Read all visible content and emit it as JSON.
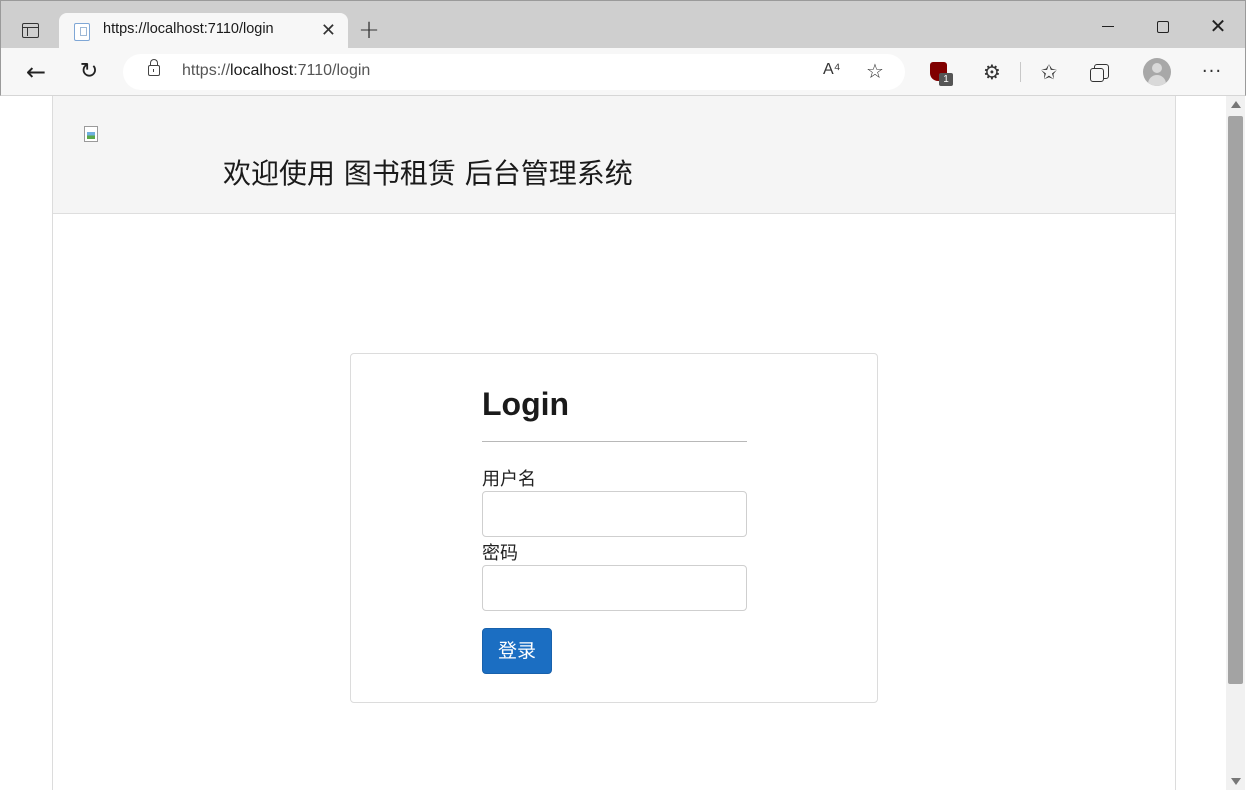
{
  "browser": {
    "tab": {
      "title": "https://localhost:7110/login",
      "close_glyph": "✕"
    },
    "new_tab_glyph": "+",
    "window_controls": {
      "close_glyph": "✕"
    },
    "address": {
      "scheme": "https://",
      "host": "localhost",
      "rest": ":7110/login",
      "read_aloud_glyph": "A⁴",
      "favorite_glyph": "☆"
    },
    "nav": {
      "back_glyph": "←",
      "reload_glyph": "↻"
    },
    "toolbar": {
      "ublock_badge": "1",
      "extensions_glyph": "⚙",
      "favorites_glyph": "✩",
      "menu_glyph": "···"
    },
    "icons": [
      "sidebar-icon",
      "back-icon",
      "reload-icon",
      "lock-icon",
      "read-aloud-icon",
      "add-favorite-icon",
      "ublock-icon",
      "extensions-icon",
      "favorites-icon",
      "collections-icon",
      "profile-avatar",
      "more-menu-icon"
    ]
  },
  "header": {
    "title": "欢迎使用 图书租赁 后台管理系统"
  },
  "login": {
    "title": "Login",
    "username_label": "用户名",
    "username_value": "",
    "password_label": "密码",
    "password_value": "",
    "submit_label": "登录"
  },
  "colors": {
    "primary_button": "#1b6ec2",
    "header_bg": "#f5f5f5",
    "chrome_bg": "#cfcfcf"
  }
}
